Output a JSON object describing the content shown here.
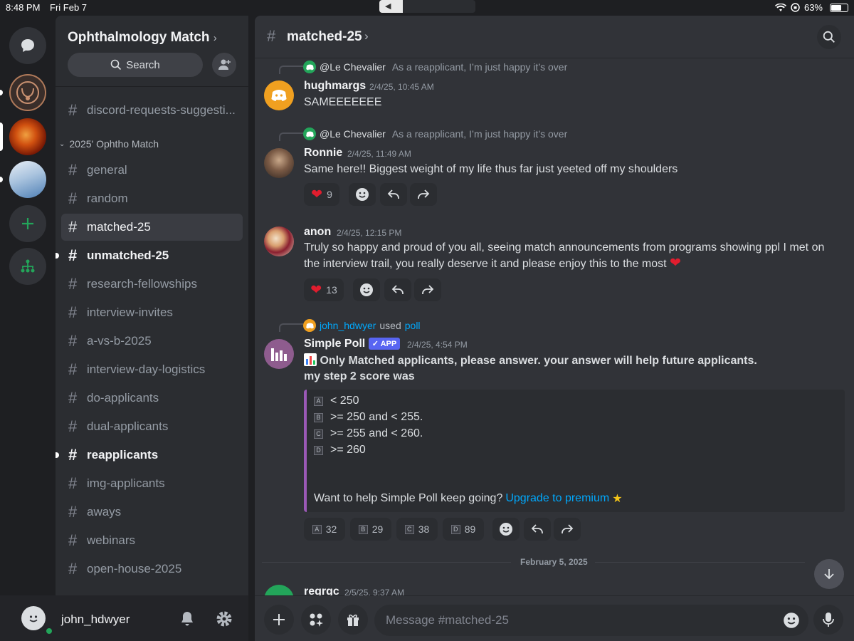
{
  "status_bar": {
    "time": "8:48 PM",
    "date": "Fri Feb 7",
    "battery": "63%",
    "battery_level": 0.63
  },
  "guild": {
    "name": "Ophthalmology Match",
    "chevron": "›",
    "search_label": "Search"
  },
  "channels": {
    "top": "discord-requests-suggesti...",
    "category": "2025' Ophtho Match",
    "items": [
      {
        "name": "general",
        "state": "normal"
      },
      {
        "name": "random",
        "state": "normal"
      },
      {
        "name": "matched-25",
        "state": "active"
      },
      {
        "name": "unmatched-25",
        "state": "unread"
      },
      {
        "name": "research-fellowships",
        "state": "normal"
      },
      {
        "name": "interview-invites",
        "state": "normal"
      },
      {
        "name": "a-vs-b-2025",
        "state": "normal"
      },
      {
        "name": "interview-day-logistics",
        "state": "normal"
      },
      {
        "name": "do-applicants",
        "state": "normal"
      },
      {
        "name": "dual-applicants",
        "state": "normal"
      },
      {
        "name": "reapplicants",
        "state": "unread"
      },
      {
        "name": "img-applicants",
        "state": "normal"
      },
      {
        "name": "aways",
        "state": "normal"
      },
      {
        "name": "webinars",
        "state": "normal"
      },
      {
        "name": "open-house-2025",
        "state": "normal"
      }
    ]
  },
  "user": {
    "name": "john_hdwyer"
  },
  "header": {
    "channel": "matched-25",
    "chevron": "›"
  },
  "messages": [
    {
      "reply_to": "@Le Chevalier",
      "reply_text": "As a reapplicant, I’m just happy it’s over",
      "author": "hughmargs",
      "time": "2/4/25, 10:45 AM",
      "text": "SAMEEEEEEE"
    },
    {
      "reply_to": "@Le Chevalier",
      "reply_text": "As a reapplicant, I’m just happy it’s over",
      "author": "Ronnie",
      "time": "2/4/25, 11:49 AM",
      "text": "Same here!! Biggest weight of my life thus far just yeeted off my shoulders",
      "heart_count": "9"
    },
    {
      "author": "anon",
      "time": "2/4/25, 12:15 PM",
      "text_line1": "Truly so happy and proud of you all, seeing match announcements from programs showing ppl I met on",
      "text_line2": "the interview trail, you really deserve it and please enjoy this to the most",
      "heart_count": "13"
    },
    {
      "used_by": "john_hdwyer",
      "used_word": "used",
      "used_cmd": "poll",
      "author": "Simple Poll",
      "tag": "✓ APP",
      "time": "2/4/25, 4:54 PM",
      "title": "Only Matched applicants, please answer. your answer will help future applicants.",
      "subtitle": "my step 2 score was",
      "options": [
        {
          "letter": "A",
          "text": "< 250"
        },
        {
          "letter": "B",
          "text": ">= 250 and < 255."
        },
        {
          "letter": "C",
          "text": ">= 255 and < 260."
        },
        {
          "letter": "D",
          "text": ">= 260"
        }
      ],
      "footer": "Want to help Simple Poll keep going?",
      "footer_link": "Upgrade to premium",
      "votes": [
        {
          "letter": "A",
          "count": "32"
        },
        {
          "letter": "B",
          "count": "29"
        },
        {
          "letter": "C",
          "count": "38"
        },
        {
          "letter": "D",
          "count": "89"
        }
      ]
    },
    {
      "author": "regrgc",
      "time": "2/5/25, 9:37 AM"
    }
  ],
  "date_divider": "February 5, 2025",
  "composer": {
    "placeholder": "Message #matched-25"
  },
  "colors": {
    "accent": "#5865f2",
    "online": "#23a55a",
    "poll_bar": "#9b59b6",
    "link": "#00a8fc"
  }
}
